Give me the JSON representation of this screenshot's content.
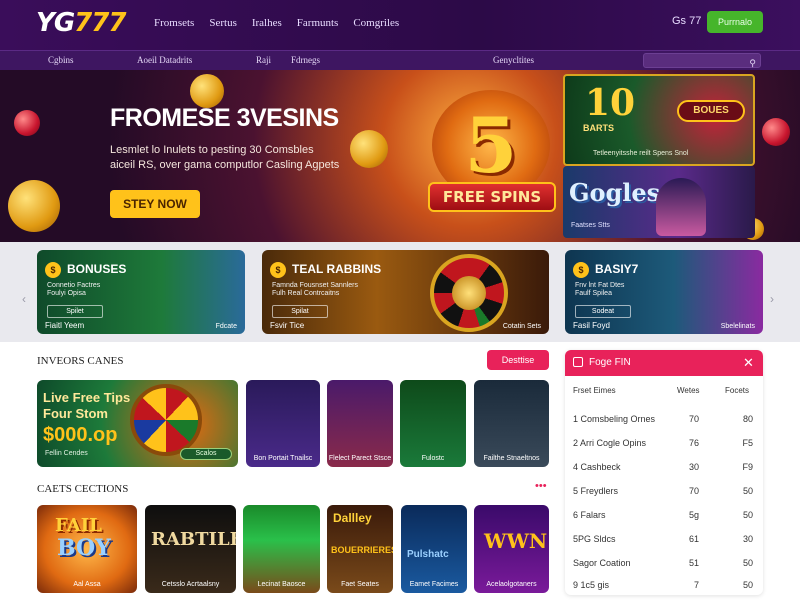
{
  "header": {
    "logo_a": "YG",
    "logo_b": "777",
    "nav": [
      "Fromsets",
      "Sertus",
      "Iralhes",
      "Farmunts",
      "Comgriles"
    ],
    "balance": "Gs 77",
    "cta_label": "Purrnalo"
  },
  "subnav": {
    "items": [
      "Cgbins",
      "Aoeil Datadrits",
      "Raji",
      "Fdrnegs",
      "Genycltites"
    ],
    "search_placeholder": ""
  },
  "hero": {
    "title": "FROMESE 3VESINS",
    "sub1": "Lesmlet lo Inulets to pesting 30 Comsbles",
    "sub2": "aiceil RS, over gama computlor Casling Agpets",
    "button_label": "STEY NOW",
    "big_number": "5",
    "free_spins": "FREE SPINS",
    "promo_top_number": "10",
    "promo_top_small": "BARTS",
    "promo_top_badge": "BOUES",
    "promo_top_caption": "Tetleenyitsshe reilt Spens Snol",
    "promo_bottom_word": "Gogles",
    "promo_bottom_caption": "Faatses Stts"
  },
  "strip": {
    "cards": [
      {
        "title": "BONUSES",
        "d1": "Connetio Factres",
        "d2": "Foulyi Opisa",
        "mini": "Spilet",
        "foot": "Fiaitl Yeem",
        "foot2": "Fdcate"
      },
      {
        "title": "TEAL RABBINS",
        "d1": "Famnda Fousnset Sannlers",
        "d2": "Fulh Real Contrcaitns",
        "mini": "Spilat",
        "foot": "Fsvir Tice",
        "foot2": "Cotatin Sets"
      },
      {
        "title": "BASIY7",
        "d1": "Fnv lnt Fat Dtes",
        "d2": "Faulf Spilea",
        "mini": "Sodeat",
        "foot": "Fasil Foyd",
        "foot2": "Sbelelinats"
      }
    ]
  },
  "section1": {
    "title": "INVEORS CANES",
    "button_label": "Desttise",
    "feature": {
      "l1": "Live Free Tips",
      "l2": "Four Stom",
      "amount": "$000.op",
      "small": "Fellin Cendes",
      "play": "Scalos"
    },
    "tiles": [
      "Bon Portait Tnailsc",
      "Flelect Parect Stsce",
      "Fulostc",
      "Failthe Stnaeltnos"
    ]
  },
  "section2": {
    "title": "CAETS CECTIONS",
    "more": "•••",
    "tiles": [
      {
        "w1": "FAIL",
        "w2": "BOY",
        "cap": "Aal Assa"
      },
      {
        "w": "RABTILE",
        "cap": "Cetsslo Acrtaalsny"
      },
      {
        "cap": "Lecinat Baosce"
      },
      {
        "w": "Dallley",
        "w2": "BOUERRIERES",
        "cap": "Faet Seates"
      },
      {
        "w": "Pulshatc",
        "cap": "Eamet Facimes"
      },
      {
        "w": "WWN",
        "cap": "Acelaolgotaners"
      }
    ]
  },
  "panel": {
    "title": "Foge FIN",
    "headers": [
      "Frset Eimes",
      "Wetes",
      "Focets"
    ],
    "rows": [
      {
        "a": "1  Comsbeling Ornes",
        "b": "70",
        "c": "80"
      },
      {
        "a": "2  Arri Cogle Opins",
        "b": "76",
        "c": "F5"
      },
      {
        "a": "4  Cashbeck",
        "b": "30",
        "c": "F9"
      },
      {
        "a": "5  Freydlers",
        "b": "70",
        "c": "50"
      },
      {
        "a": "6  Falars",
        "b": "5g",
        "c": "50"
      },
      {
        "a": "5PG  Sldcs",
        "b": "61",
        "c": "30"
      },
      {
        "a": "Sagor Coation",
        "b": "51",
        "c": "50"
      },
      {
        "a": "9  1c5  gis",
        "b": "7",
        "c": "50"
      }
    ]
  },
  "colors": {
    "accent": "#e8225a",
    "brand_purple": "#3a0d5a",
    "gold": "#ffc21a",
    "green": "#46b52b"
  }
}
